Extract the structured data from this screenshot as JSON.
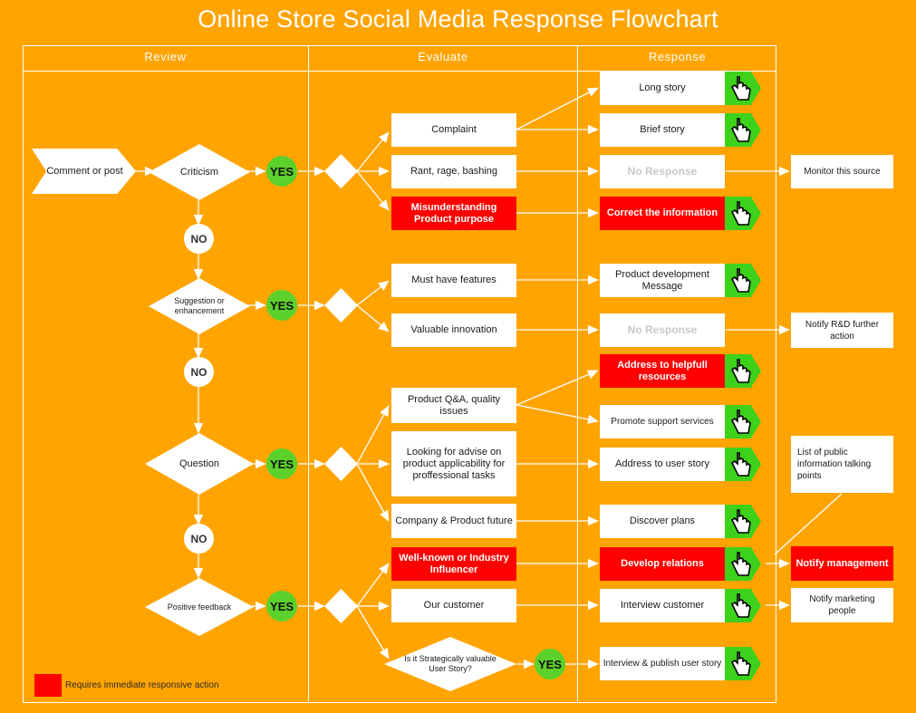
{
  "title": "Online Store Social Media Response Flowchart",
  "columns": [
    {
      "label": "Review"
    },
    {
      "label": "Evaluate"
    },
    {
      "label": "Response"
    }
  ],
  "review": {
    "start": {
      "label": "Comment or post"
    },
    "decisions": [
      {
        "label": "Criticism"
      },
      {
        "label": "Suggestion or enhancement"
      },
      {
        "label": "Question"
      },
      {
        "label": "Positive feedback"
      }
    ],
    "yes_label": "YES",
    "no_label": "NO",
    "no_count": 3
  },
  "evaluate": {
    "items": [
      {
        "label": "Complaint",
        "style": "white"
      },
      {
        "label": "Rant, rage, bashing",
        "style": "white"
      },
      {
        "label": "Misunderstanding Product purpose",
        "style": "red"
      },
      {
        "label": "Must have features",
        "style": "white"
      },
      {
        "label": "Valuable innovation",
        "style": "white"
      },
      {
        "label": "Product Q&A, quality issues",
        "style": "white"
      },
      {
        "label": "Looking for advise on product applicability for proffessional tasks",
        "style": "white"
      },
      {
        "label": "Company & Product future",
        "style": "white"
      },
      {
        "label": "Well-known or Industry Influencer",
        "style": "red"
      },
      {
        "label": "Our customer",
        "style": "white"
      }
    ],
    "decision": {
      "label": "Is it Strategically valuable User Story?"
    },
    "decision_yes_label": "YES"
  },
  "response": {
    "items": [
      {
        "label": "Long story",
        "style": "white",
        "tag": true
      },
      {
        "label": "Brief story",
        "style": "white",
        "tag": true
      },
      {
        "label": "No Response",
        "style": "muted",
        "tag": false
      },
      {
        "label": "Correct the information",
        "style": "red",
        "tag": true
      },
      {
        "label": "Product development Message",
        "style": "white",
        "tag": true
      },
      {
        "label": "No Response",
        "style": "muted",
        "tag": false
      },
      {
        "label": "Address to helpfull resources",
        "style": "red",
        "tag": true
      },
      {
        "label": "Promote support services",
        "style": "white",
        "tag": true
      },
      {
        "label": "Address to user story",
        "style": "white",
        "tag": true
      },
      {
        "label": "Discover plans",
        "style": "white",
        "tag": true
      },
      {
        "label": "Develop relations",
        "style": "red",
        "tag": true
      },
      {
        "label": "Interview customer",
        "style": "white",
        "tag": true
      },
      {
        "label": "Interview & publish user story",
        "style": "white",
        "tag": true
      }
    ],
    "tag_icon": "hand-pointer-icon"
  },
  "outcomes": [
    {
      "label": "Monitor this source",
      "style": "white"
    },
    {
      "label": "Notify R&D further action",
      "style": "white"
    },
    {
      "label": "List of public information talking points",
      "style": "white",
      "align": "left"
    },
    {
      "label": "Notify management",
      "style": "red"
    },
    {
      "label": "Notify marketing people",
      "style": "white"
    }
  ],
  "legend": {
    "swatch_color": "#FF0000",
    "text": "Requires immediate responsive action"
  },
  "colors": {
    "background": "#FFA400",
    "accent_green": "#3DD11B",
    "yes_green": "#5DD12B",
    "alert_red": "#FF0000",
    "shape_fill": "#FFFFFF",
    "line": "#FFFFFF"
  }
}
